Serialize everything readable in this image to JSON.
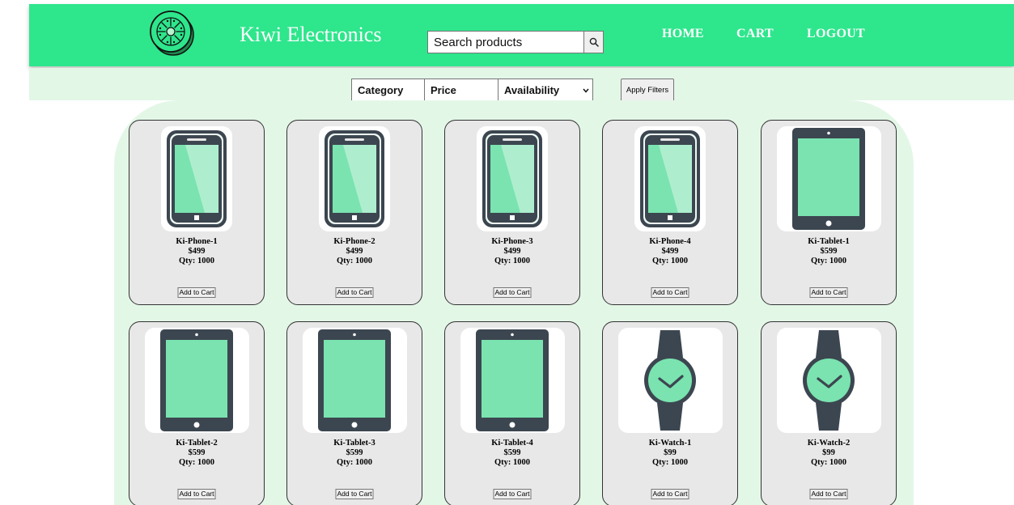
{
  "header": {
    "brand": "Kiwi Electronics",
    "search_placeholder": "Search products",
    "nav": {
      "home": "HOME",
      "cart": "CART",
      "logout": "LOGOUT"
    }
  },
  "filters": {
    "category": "Category",
    "price": "Price",
    "availability": "Availability",
    "apply_label": "Apply Filters"
  },
  "add_to_cart_label": "Add to Cart",
  "products": [
    {
      "name": "Ki-Phone-1",
      "price": "$499",
      "qty": "Qty: 1000",
      "icon": "phone-icon"
    },
    {
      "name": "Ki-Phone-2",
      "price": "$499",
      "qty": "Qty: 1000",
      "icon": "phone-icon"
    },
    {
      "name": "Ki-Phone-3",
      "price": "$499",
      "qty": "Qty: 1000",
      "icon": "phone-icon"
    },
    {
      "name": "Ki-Phone-4",
      "price": "$499",
      "qty": "Qty: 1000",
      "icon": "phone-icon"
    },
    {
      "name": "Ki-Tablet-1",
      "price": "$599",
      "qty": "Qty: 1000",
      "icon": "tablet-icon"
    },
    {
      "name": "Ki-Tablet-2",
      "price": "$599",
      "qty": "Qty: 1000",
      "icon": "tablet-icon"
    },
    {
      "name": "Ki-Tablet-3",
      "price": "$599",
      "qty": "Qty: 1000",
      "icon": "tablet-icon"
    },
    {
      "name": "Ki-Tablet-4",
      "price": "$599",
      "qty": "Qty: 1000",
      "icon": "tablet-icon"
    },
    {
      "name": "Ki-Watch-1",
      "price": "$99",
      "qty": "Qty: 1000",
      "icon": "watch-icon"
    },
    {
      "name": "Ki-Watch-2",
      "price": "$99",
      "qty": "Qty: 1000",
      "icon": "watch-icon"
    }
  ],
  "colors": {
    "header_bg": "#2ee68c",
    "page_tint": "#e3f7e7",
    "device_dark": "#3c4650",
    "screen_green": "#7ae3b0",
    "screen_light": "#aeeecf"
  }
}
